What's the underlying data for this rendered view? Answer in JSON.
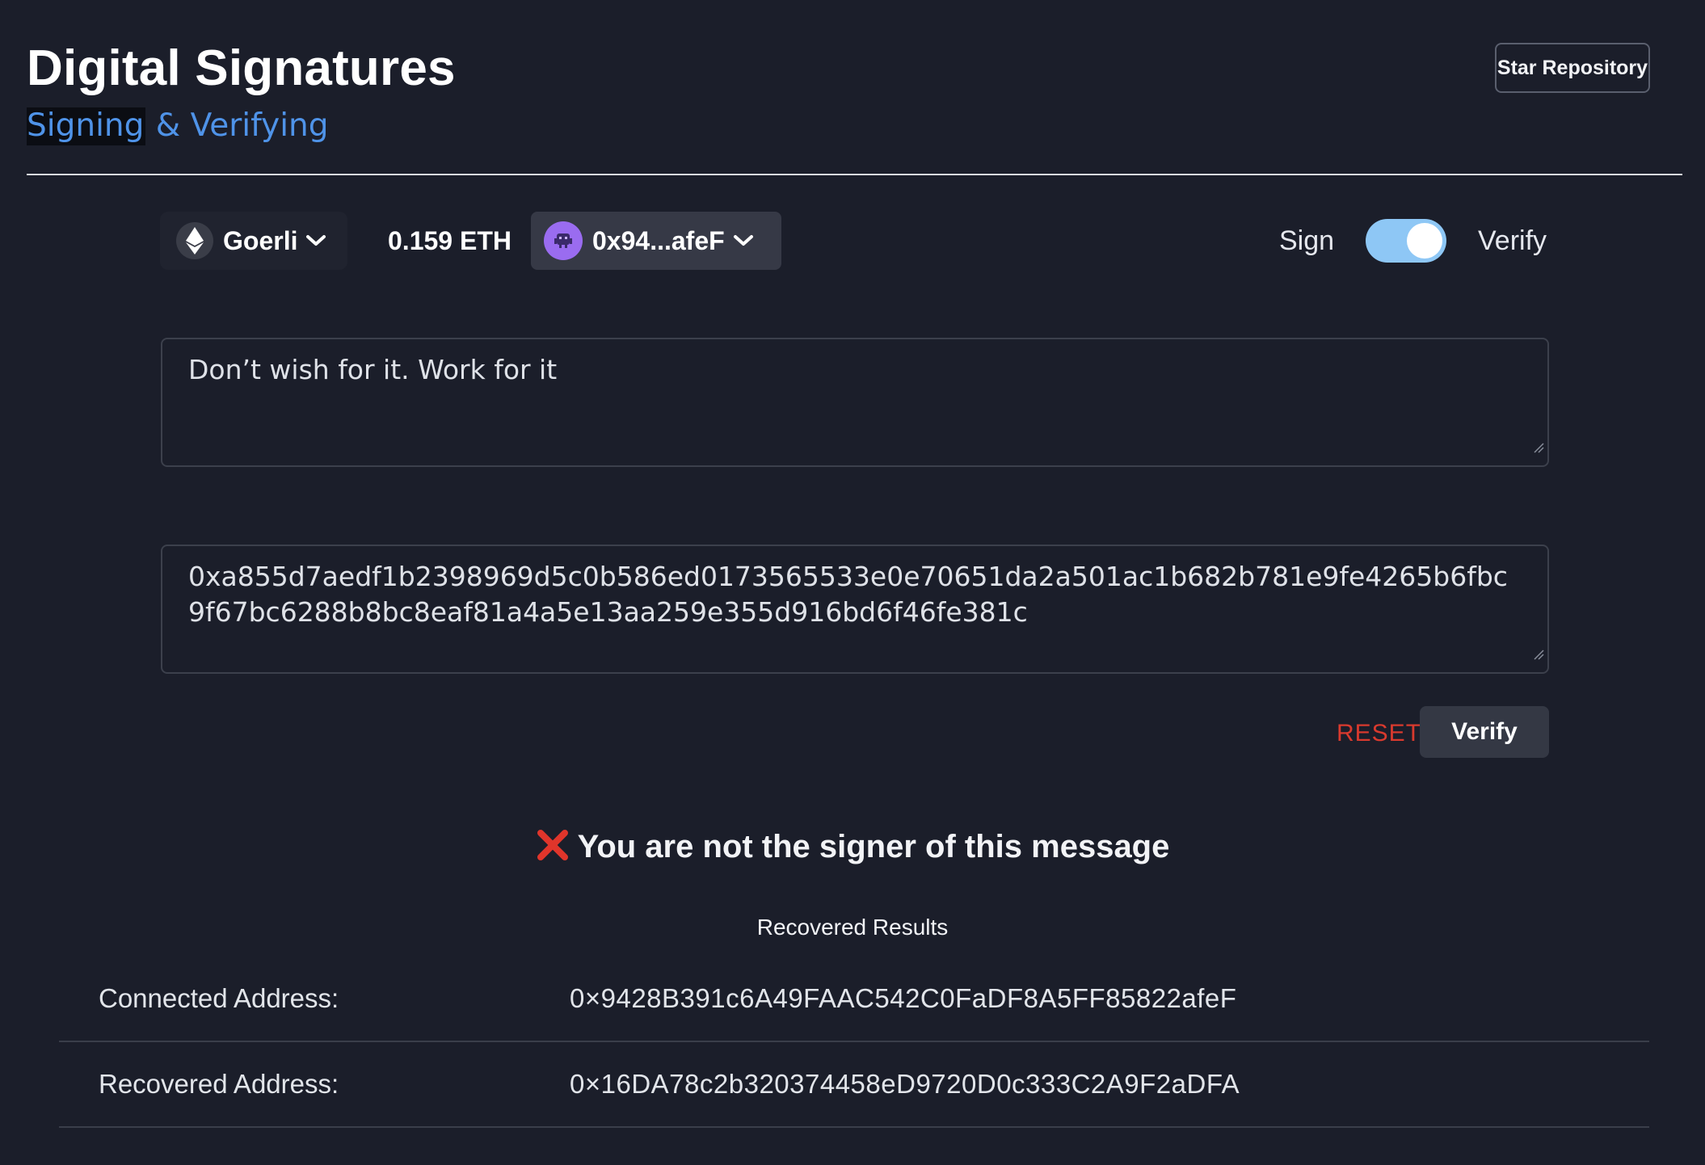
{
  "header": {
    "title": "Digital Signatures",
    "subtitle_highlight": "Signing",
    "subtitle_rest": " & Verifying",
    "star_button": "Star Repository"
  },
  "wallet": {
    "network": "Goerli",
    "balance": "0.159 ETH",
    "account": "0x94...afeF"
  },
  "mode": {
    "sign_label": "Sign",
    "verify_label": "Verify",
    "selected": "Verify"
  },
  "form": {
    "message": "Don’t wish for it. Work for it",
    "signature": "0xa855d7aedf1b2398969d5c0b586ed0173565533e0e70651da2a501ac1b682b781e9fe4265b6fbc9f67bc6288b8bc8eaf81a4a5e13aa259e355d916bd6f46fe381c",
    "reset_label": "RESET",
    "verify_label": "Verify"
  },
  "result": {
    "icon": "cross-mark-icon",
    "message": "You are not the signer of this message",
    "status_color": "#e0352b"
  },
  "recovered": {
    "title": "Recovered Results",
    "rows": [
      {
        "label": "Connected Address:",
        "value": "0×9428B391c6A49FAAC542C0FaDF8A5FF85822afeF"
      },
      {
        "label": "Recovered Address:",
        "value": "0×16DA78c2b320374458eD9720D0c333C2A9F2aDFA"
      }
    ]
  }
}
